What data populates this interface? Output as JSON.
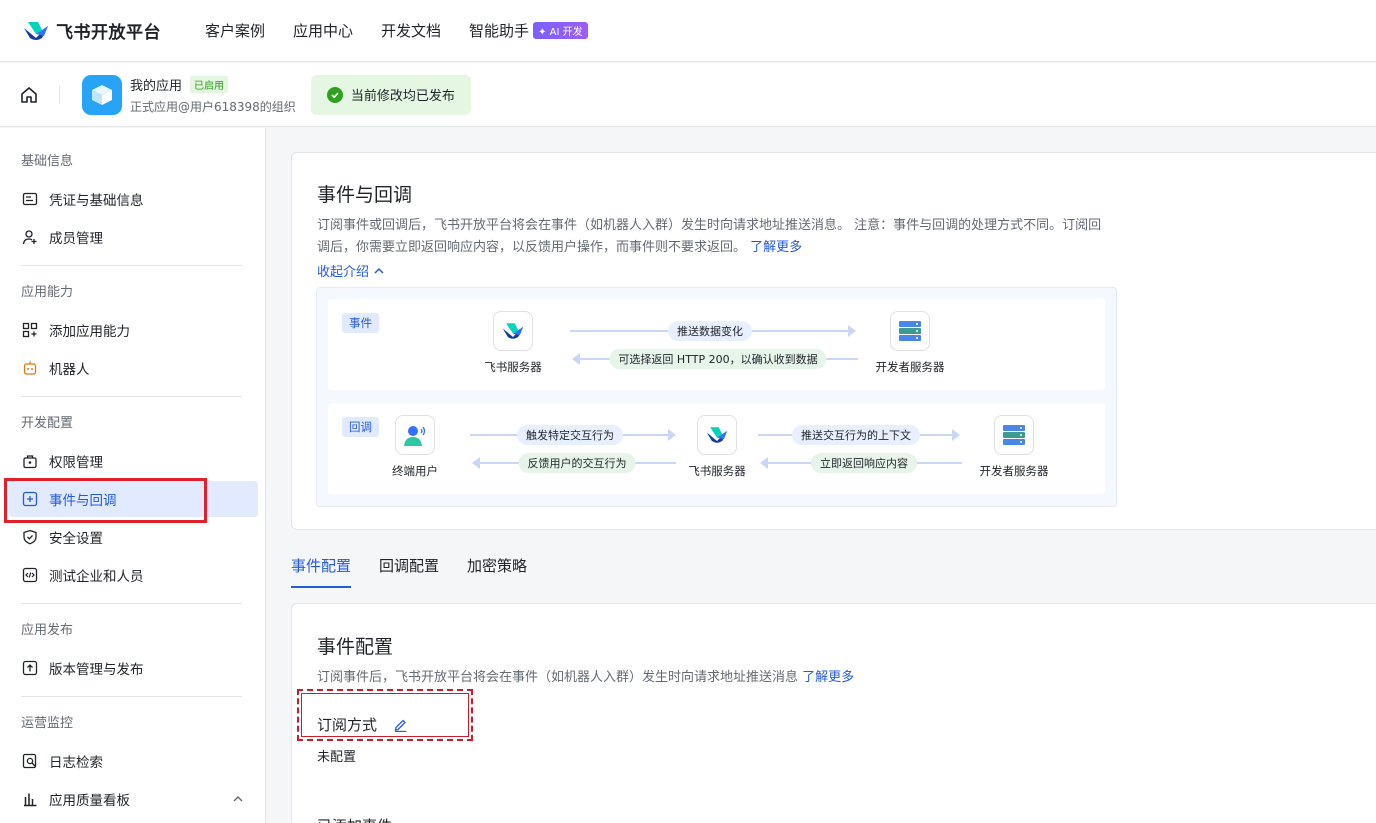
{
  "topnav": {
    "brand": "飞书开放平台",
    "items": [
      "客户案例",
      "应用中心",
      "开发文档",
      "智能助手"
    ],
    "ai_badge": "✦ AI 开发"
  },
  "appbar": {
    "app_name": "我的应用",
    "status": "已启用",
    "app_sub": "正式应用@用户618398的组织",
    "publish_notice": "当前修改均已发布"
  },
  "sidebar": {
    "groups": [
      "基础信息",
      "应用能力",
      "开发配置",
      "应用发布",
      "运营监控"
    ],
    "items": [
      "凭证与基础信息",
      "成员管理",
      "添加应用能力",
      "机器人",
      "权限管理",
      "事件与回调",
      "安全设置",
      "测试企业和人员",
      "版本管理与发布",
      "日志检索",
      "应用质量看板"
    ]
  },
  "intro": {
    "title": "事件与回调",
    "desc": "订阅事件或回调后，飞书开放平台将会在事件（如机器人入群）发生时向请求地址推送消息。 注意：事件与回调的处理方式不同。订阅回调后，你需要立即返回响应内容，以反馈用户操作，而事件则不要求返回。",
    "learn_more": "了解更多",
    "collapse": "收起介绍"
  },
  "diagram": {
    "event_tag": "事件",
    "callback_tag": "回调",
    "feishu_server": "飞书服务器",
    "dev_server": "开发者服务器",
    "end_user": "终端用户",
    "event_push": "推送数据变化",
    "event_ack": "可选择返回 HTTP 200，以确认收到数据",
    "cb_trigger": "触发特定交互行为",
    "cb_feedback": "反馈用户的交互行为",
    "cb_push": "推送交互行为的上下文",
    "cb_reply": "立即返回响应内容"
  },
  "tabs": [
    "事件配置",
    "回调配置",
    "加密策略"
  ],
  "event_config": {
    "title": "事件配置",
    "desc": "订阅事件后，飞书开放平台将会在事件（如机器人入群）发生时向请求地址推送消息",
    "learn_more": "了解更多",
    "subscribe_label": "订阅方式",
    "subscribe_value": "未配置",
    "added_events": "已添加事件"
  },
  "colors": {
    "accent": "#245bdb",
    "success": "#2ea121",
    "highlight": "#e0202a"
  }
}
